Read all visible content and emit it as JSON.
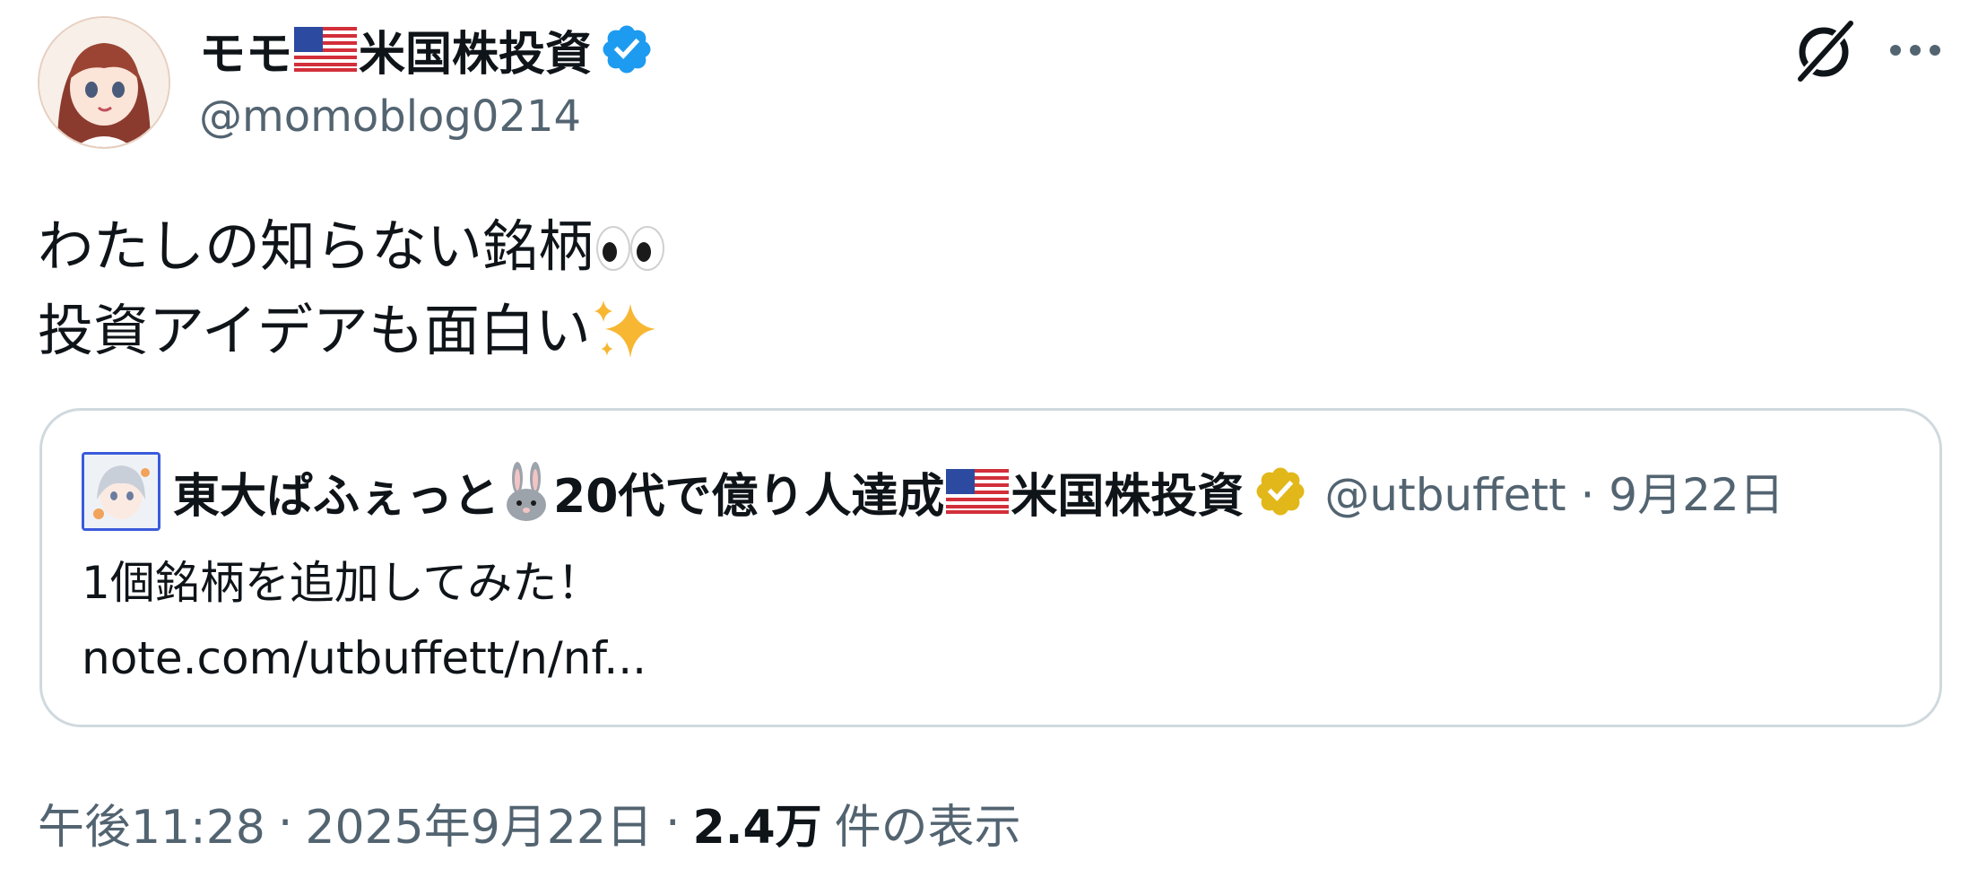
{
  "author": {
    "name_part1": "モモ",
    "name_part2": "米国株投資",
    "handle": "@momoblog0214"
  },
  "post": {
    "line1": "わたしの知らない銘柄",
    "line2": "投資アイデアも面白い"
  },
  "quote": {
    "name_part1": "東大ぱふぇっと",
    "name_part2": "20代で億り人達成",
    "name_part3": "米国株投資",
    "handle": "@utbuffett",
    "dot": "·",
    "date": "9月22日",
    "line1": "1個銘柄を追加してみた！",
    "line2": "note.com/utbuffett/n/nf..."
  },
  "footer": {
    "time": "午後11:28",
    "sep": "·",
    "date": "2025年9月22日",
    "views": "2.4万",
    "views_label": "件の表示"
  },
  "colors": {
    "verified_blue": "#1d9bf0",
    "verified_gold": "#e2b719",
    "secondary_text": "#536471"
  },
  "icons": {
    "grok": "grok-icon",
    "more": "more-icon",
    "eyes": "eyes-emoji",
    "sparkles": "sparkles-emoji",
    "rabbit": "rabbit-emoji",
    "flag": "us-flag-emoji"
  }
}
